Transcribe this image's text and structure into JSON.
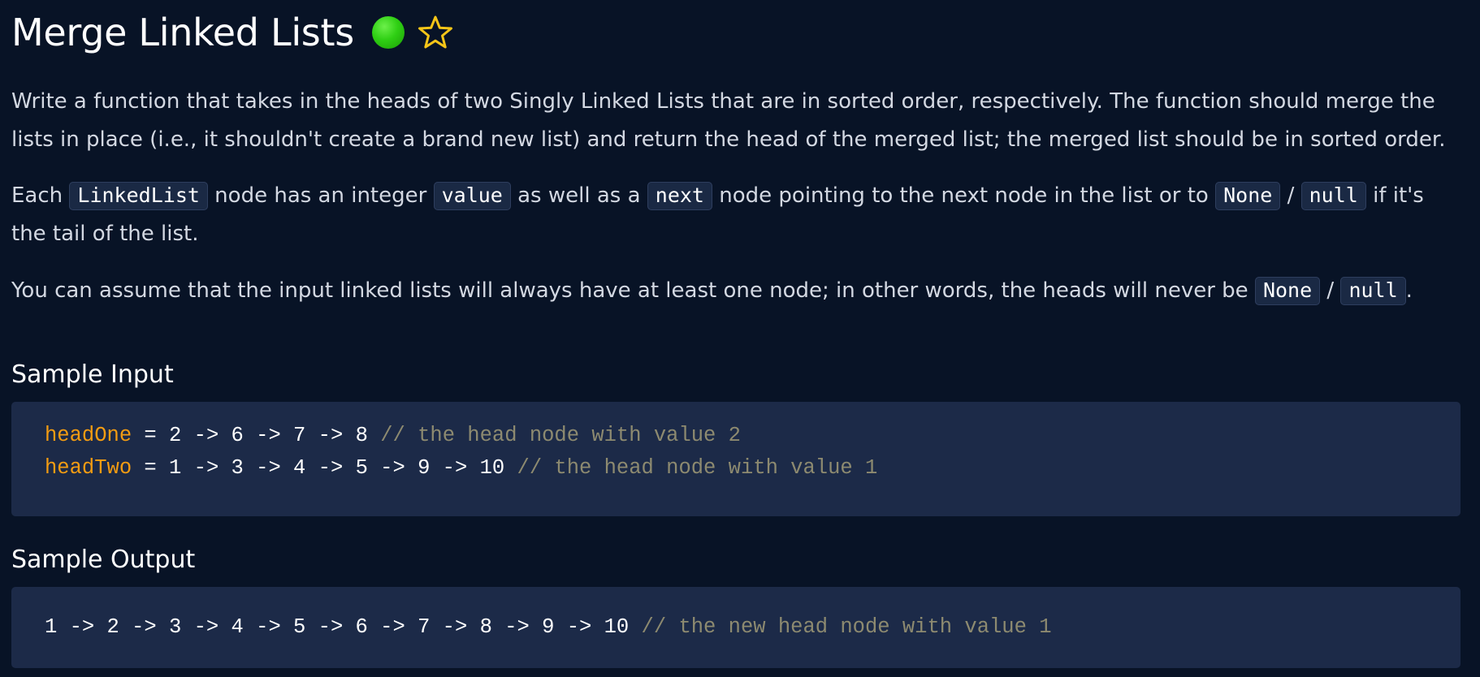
{
  "problem": {
    "title": "Merge Linked Lists",
    "difficulty_color": "#2fcf14"
  },
  "description": {
    "p1": "Write a function that takes in the heads of two Singly Linked Lists that are in sorted order, respectively. The function should merge the lists in place (i.e., it shouldn't create a brand new list) and return the head of the merged list; the merged list should be in sorted order.",
    "p2": {
      "t1": "Each ",
      "c1": "LinkedList",
      "t2": " node has an integer ",
      "c2": "value",
      "t3": " as well as a ",
      "c3": "next",
      "t4": " node pointing to the next node in the list or to ",
      "c4": "None",
      "t5": " / ",
      "c5": "null",
      "t6": " if it's the tail of the list."
    },
    "p3": {
      "t1": "You can assume that the input linked lists will always have at least one node; in other words, the heads will never be ",
      "c1": "None",
      "t2": " / ",
      "c2": "null",
      "t3": "."
    }
  },
  "sample_input": {
    "heading": "Sample Input",
    "lines": [
      {
        "var": "headOne",
        "code": " = 2 -> 6 -> 7 -> 8 ",
        "comment": "// the head node with value 2"
      },
      {
        "var": "headTwo",
        "code": " = 1 -> 3 -> 4 -> 5 -> 9 -> 10 ",
        "comment": "// the head node with value 1"
      }
    ]
  },
  "sample_output": {
    "heading": "Sample Output",
    "code": "1 -> 2 -> 3 -> 4 -> 5 -> 6 -> 7 -> 8 -> 9 -> 10 ",
    "comment": "// the new head node with value 1"
  }
}
